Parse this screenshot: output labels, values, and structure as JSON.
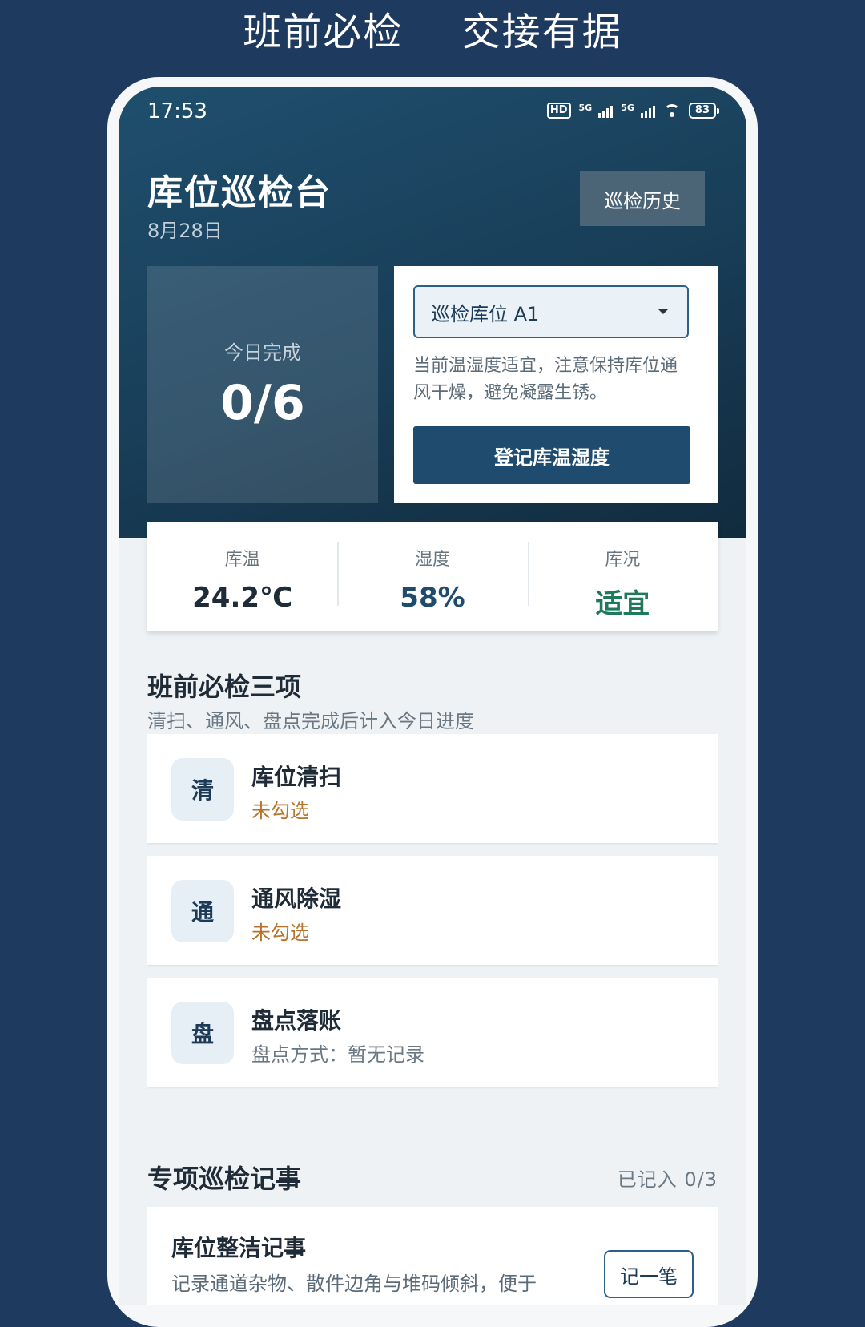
{
  "banner": {
    "left": "班前必检",
    "right": "交接有据"
  },
  "status_bar": {
    "time": "17:53",
    "hd": "HD",
    "net1": "5G",
    "net2": "5G",
    "battery": "83"
  },
  "header": {
    "title": "库位巡检台",
    "date": "8月28日",
    "history_button": "巡检历史"
  },
  "progress": {
    "label": "今日完成",
    "value": "0/6"
  },
  "zone": {
    "selected": "巡检库位 A1",
    "note": "当前温湿度适宜，注意保持库位通风干燥，避免凝露生锈。",
    "record_button": "登记库温湿度"
  },
  "metrics": [
    {
      "label": "库温",
      "value": "24.2℃",
      "color": "#1f2b36"
    },
    {
      "label": "湿度",
      "value": "58%",
      "color": "#1e4b6e"
    },
    {
      "label": "库况",
      "value": "适宜",
      "color": "#1e7a5a"
    }
  ],
  "checklist": {
    "title": "班前必检三项",
    "subtitle": "清扫、通风、盘点完成后计入今日进度",
    "items": [
      {
        "icon": "清",
        "name": "库位清扫",
        "status": "未勾选",
        "status_color": "#b8732a"
      },
      {
        "icon": "通",
        "name": "通风除湿",
        "status": "未勾选",
        "status_color": "#b8732a"
      },
      {
        "icon": "盘",
        "name": "盘点落账",
        "status": "盘点方式：暂无记录",
        "status_color": "#6a7884"
      }
    ]
  },
  "special": {
    "title": "专项巡检记事",
    "count": "已记入  0/3",
    "cards": [
      {
        "title": "库位整洁记事",
        "desc": "记录通道杂物、散件边角与堆码倾斜，便于",
        "button": "记一笔"
      }
    ]
  }
}
